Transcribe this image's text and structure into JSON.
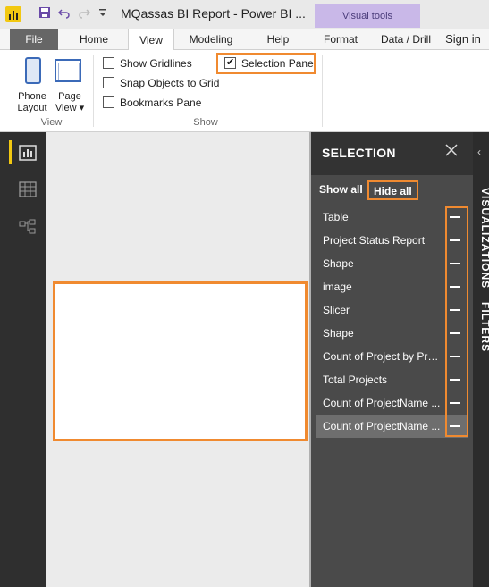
{
  "window": {
    "title": "MQassas BI Report - Power BI ...",
    "context_tab_group": "Visual tools",
    "app_icon": "powerbi-icon",
    "quick_access": [
      "save-icon",
      "undo-icon",
      "redo-icon",
      "customize-dropdown-icon"
    ]
  },
  "ribbon": {
    "tabs": [
      "File",
      "Home",
      "View",
      "Modeling",
      "Help",
      "Format",
      "Data / Drill"
    ],
    "active_tab": "View",
    "sign_in": "Sign in",
    "view_group": {
      "label": "View",
      "phone_layout": "Phone Layout",
      "page_view": "Page View"
    },
    "show_group": {
      "label": "Show",
      "gridlines": {
        "label": "Show Gridlines",
        "checked": false
      },
      "snap": {
        "label": "Snap Objects to Grid",
        "checked": false
      },
      "bookmarks": {
        "label": "Bookmarks Pane",
        "checked": false
      },
      "selection": {
        "label": "Selection Pane",
        "checked": true
      }
    }
  },
  "left_nav": {
    "items": [
      "report-view-icon",
      "data-view-icon",
      "relationships-view-icon"
    ],
    "active": "report-view-icon"
  },
  "selection_pane": {
    "title": "SELECTION",
    "show_all": "Show all",
    "hide_all": "Hide all",
    "layers": [
      {
        "name": "Table",
        "selected": false
      },
      {
        "name": "Project Status Report",
        "selected": false
      },
      {
        "name": "Shape",
        "selected": false
      },
      {
        "name": "image",
        "selected": false
      },
      {
        "name": "Slicer",
        "selected": false
      },
      {
        "name": "Shape",
        "selected": false
      },
      {
        "name": "Count of Project by Pro...",
        "selected": false
      },
      {
        "name": "Total Projects",
        "selected": false
      },
      {
        "name": "Count of ProjectName ...",
        "selected": false
      },
      {
        "name": "Count of ProjectName ...",
        "selected": true
      }
    ]
  },
  "right_panes": {
    "visualizations": "VISUALIZATIONS",
    "filters": "FILTERS"
  },
  "colors": {
    "highlight": "#f08a30",
    "pane_bg": "#4a4a4a",
    "nav_bg": "#2f2f2f",
    "accent": "#f2c811"
  }
}
